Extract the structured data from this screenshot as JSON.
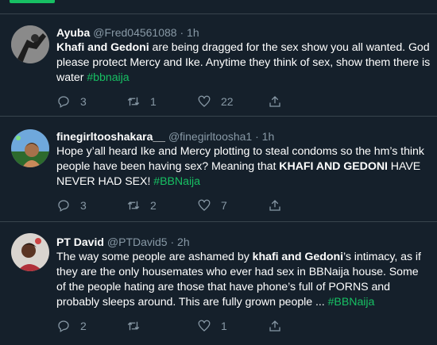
{
  "tweets": [
    {
      "name": "Ayuba",
      "handle": "@Fred04561088",
      "separator": "·",
      "time": "1h",
      "body": [
        {
          "text": "Khafi and Gedoni",
          "style": "bold"
        },
        {
          "text": " are being dragged for the sex show you all wanted. God please protect Mercy and Ike. Anytime they think of sex, show them there is water ",
          "style": "normal"
        },
        {
          "text": "#bbnaija",
          "style": "hashtag"
        }
      ],
      "replies": "3",
      "retweets": "1",
      "likes": "22"
    },
    {
      "name": "finegirltooshakara__",
      "handle": "@finegirltoosha1",
      "separator": "·",
      "time": "1h",
      "body": [
        {
          "text": "Hope y’all heard Ike and Mercy plotting to steal condoms so the hm’s think people have been having sex? Meaning that ",
          "style": "normal"
        },
        {
          "text": "KHAFI AND GEDONI",
          "style": "bold"
        },
        {
          "text": " HAVE NEVER HAD SEX! ",
          "style": "normal"
        },
        {
          "text": "#BBNaija",
          "style": "hashtag"
        }
      ],
      "replies": "3",
      "retweets": "2",
      "likes": "7"
    },
    {
      "name": "PT David",
      "handle": "@PTDavid5",
      "separator": "·",
      "time": "2h",
      "body": [
        {
          "text": "The way some people are ashamed by ",
          "style": "normal"
        },
        {
          "text": "khafi and Gedoni",
          "style": "bold"
        },
        {
          "text": "’s intimacy, as if they are the only  housemates who ever had  sex in BBNaija house. Some of the people hating are  those that have phone’s full of PORNS and probably sleeps around. This are fully grown  people ... ",
          "style": "normal"
        },
        {
          "text": "#BBNaija",
          "style": "hashtag"
        }
      ],
      "replies": "2",
      "retweets": "",
      "likes": "1"
    }
  ],
  "icons": [
    "reply-icon",
    "retweet-icon",
    "like-icon",
    "share-icon"
  ],
  "colors": {
    "background": "#15202b",
    "divider": "#38444d",
    "muted": "#8899a6",
    "hashtag": "#17bf63"
  }
}
